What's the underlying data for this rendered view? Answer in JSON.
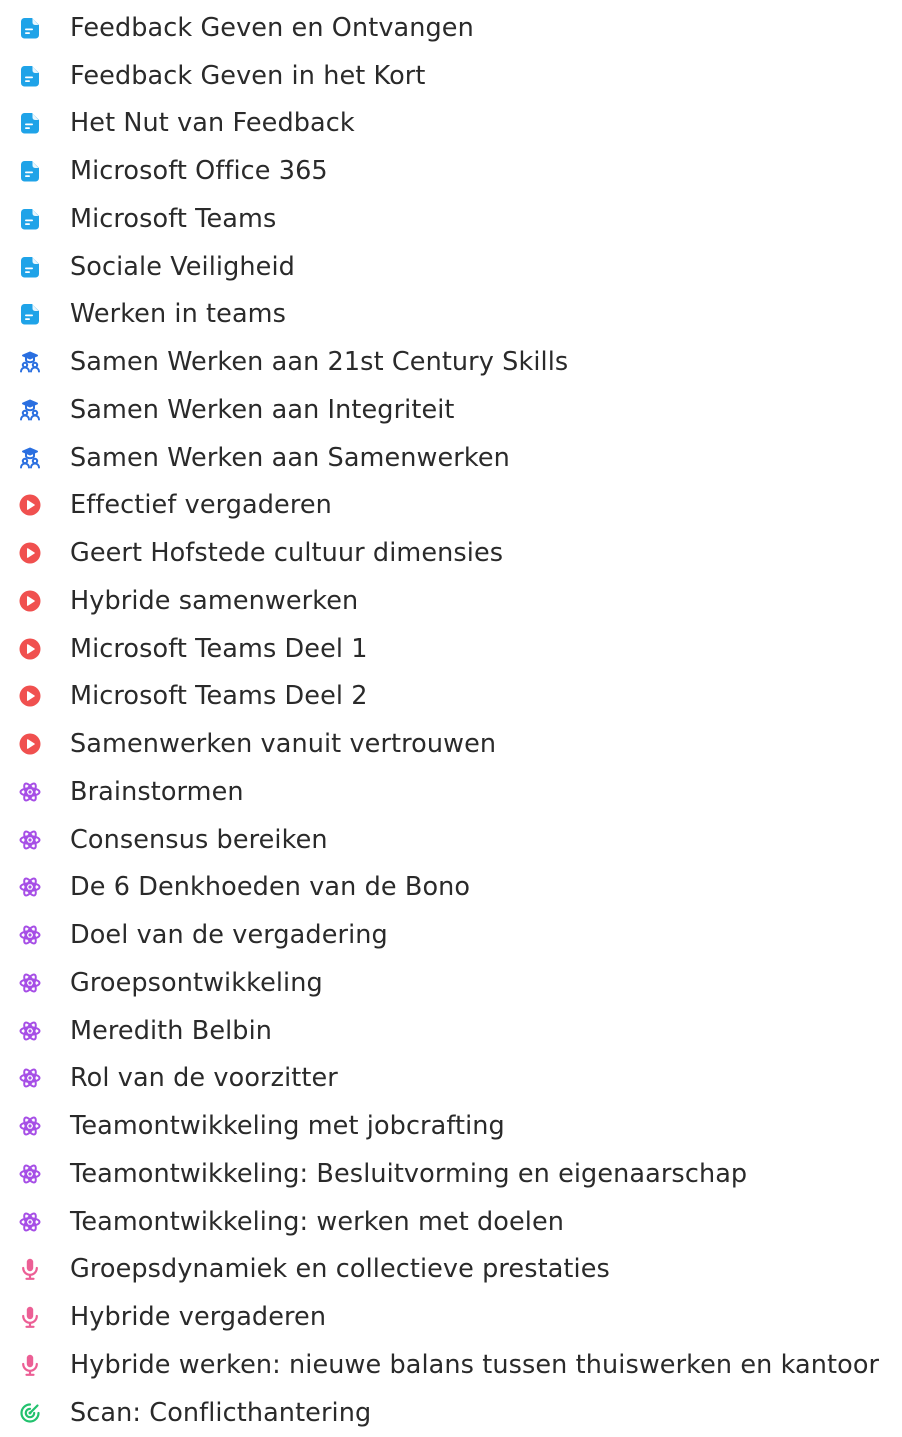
{
  "colors": {
    "document": "#1fa3e8",
    "course": "#2a6fe0",
    "video": "#f0504f",
    "skill": "#a64ee6",
    "podcast": "#ec5f95",
    "scan": "#22c26e",
    "text": "#2a2a2a"
  },
  "items": [
    {
      "label": "Feedback Geven en Ontvangen",
      "icon": "document-icon"
    },
    {
      "label": "Feedback Geven in het Kort",
      "icon": "document-icon"
    },
    {
      "label": "Het Nut van Feedback",
      "icon": "document-icon"
    },
    {
      "label": "Microsoft Office 365",
      "icon": "document-icon"
    },
    {
      "label": "Microsoft Teams",
      "icon": "document-icon"
    },
    {
      "label": "Sociale Veiligheid",
      "icon": "document-icon"
    },
    {
      "label": "Werken in teams",
      "icon": "document-icon"
    },
    {
      "label": "Samen Werken aan 21st Century Skills",
      "icon": "course-group-icon"
    },
    {
      "label": "Samen Werken aan Integriteit",
      "icon": "course-group-icon"
    },
    {
      "label": "Samen Werken aan Samenwerken",
      "icon": "course-group-icon"
    },
    {
      "label": "Effectief vergaderen",
      "icon": "play-icon"
    },
    {
      "label": "Geert Hofstede cultuur dimensies",
      "icon": "play-icon"
    },
    {
      "label": "Hybride samenwerken",
      "icon": "play-icon"
    },
    {
      "label": "Microsoft Teams Deel 1",
      "icon": "play-icon"
    },
    {
      "label": "Microsoft Teams Deel 2",
      "icon": "play-icon"
    },
    {
      "label": "Samenwerken vanuit vertrouwen",
      "icon": "play-icon"
    },
    {
      "label": "Brainstormen",
      "icon": "atom-icon"
    },
    {
      "label": "Consensus bereiken",
      "icon": "atom-icon"
    },
    {
      "label": "De 6 Denkhoeden van de Bono",
      "icon": "atom-icon"
    },
    {
      "label": "Doel van de vergadering",
      "icon": "atom-icon"
    },
    {
      "label": "Groepsontwikkeling",
      "icon": "atom-icon"
    },
    {
      "label": "Meredith Belbin",
      "icon": "atom-icon"
    },
    {
      "label": "Rol van de voorzitter",
      "icon": "atom-icon"
    },
    {
      "label": "Teamontwikkeling met jobcrafting",
      "icon": "atom-icon"
    },
    {
      "label": "Teamontwikkeling: Besluitvorming en eigenaarschap",
      "icon": "atom-icon"
    },
    {
      "label": "Teamontwikkeling: werken met doelen",
      "icon": "atom-icon"
    },
    {
      "label": "Groepsdynamiek en collectieve prestaties",
      "icon": "microphone-icon"
    },
    {
      "label": "Hybride vergaderen",
      "icon": "microphone-icon"
    },
    {
      "label": "Hybride werken: nieuwe balans tussen thuiswerken en kantoor",
      "icon": "microphone-icon"
    },
    {
      "label": "Scan: Conflicthantering",
      "icon": "scan-icon"
    }
  ]
}
